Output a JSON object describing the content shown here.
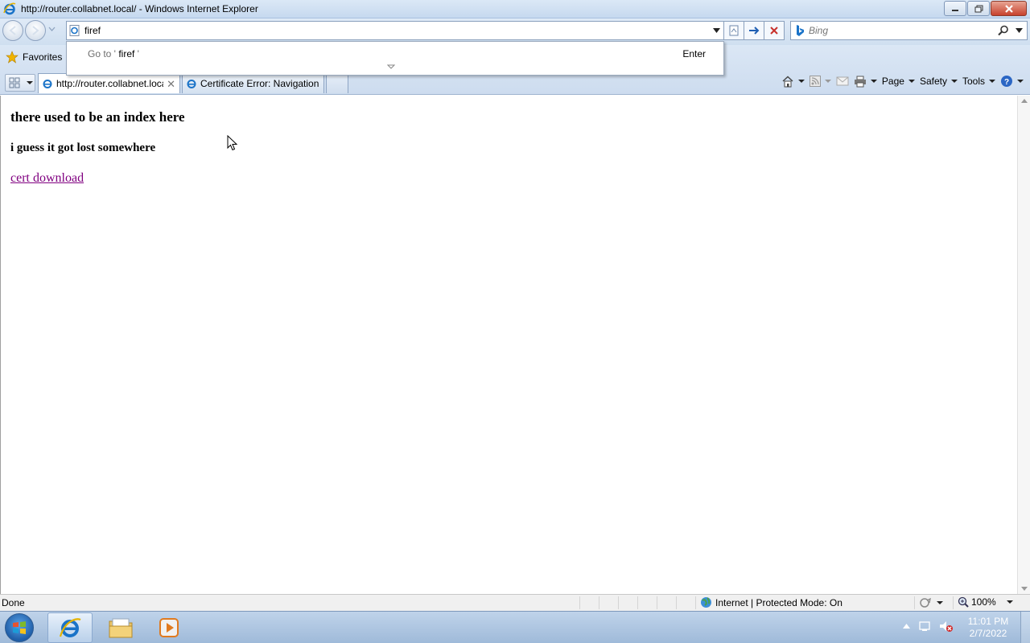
{
  "window": {
    "title": "http://router.collabnet.local/ - Windows Internet Explorer"
  },
  "address_bar": {
    "value": "firef"
  },
  "search": {
    "placeholder": "Bing"
  },
  "autocomplete": {
    "goto_prefix": "Go to '",
    "query": " firef ",
    "goto_suffix": "'",
    "enter_label": "Enter"
  },
  "favorites": {
    "label": "Favorites"
  },
  "tabs": [
    {
      "label": "http://router.collabnet.local/"
    },
    {
      "label": "Certificate Error: Navigation Blocked"
    }
  ],
  "command_bar": {
    "page": "Page",
    "safety": "Safety",
    "tools": "Tools"
  },
  "page": {
    "heading1": "there used to be an index here",
    "heading2": "i guess it got lost somewhere",
    "link": "cert download"
  },
  "status_bar": {
    "status": "Done",
    "zone": "Internet | Protected Mode: On",
    "zoom": "100%"
  },
  "taskbar": {
    "time": "11:01 PM",
    "date": "2/7/2022"
  },
  "colors": {
    "visited_link": "#800080",
    "chrome": "#cfdff0"
  }
}
